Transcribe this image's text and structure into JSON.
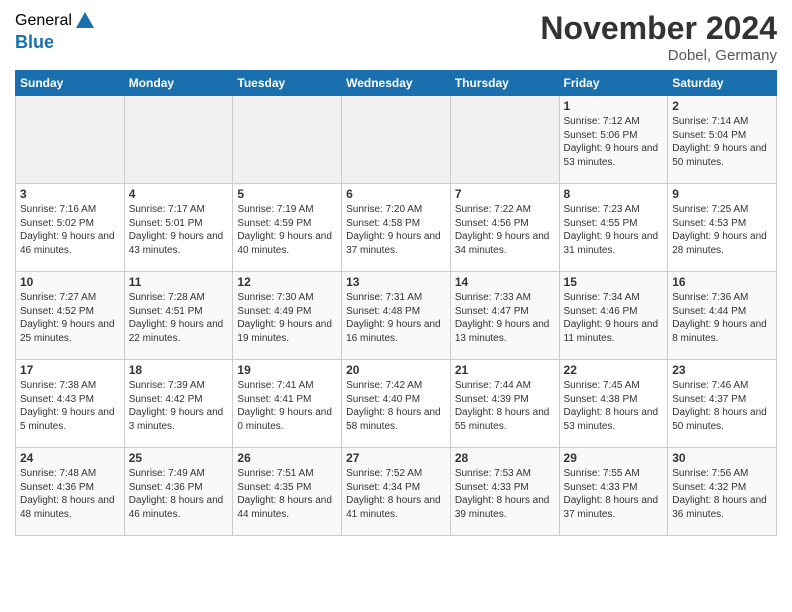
{
  "header": {
    "logo_general": "General",
    "logo_blue": "Blue",
    "title": "November 2024",
    "location": "Dobel, Germany"
  },
  "weekdays": [
    "Sunday",
    "Monday",
    "Tuesday",
    "Wednesday",
    "Thursday",
    "Friday",
    "Saturday"
  ],
  "weeks": [
    [
      {
        "day": "",
        "info": ""
      },
      {
        "day": "",
        "info": ""
      },
      {
        "day": "",
        "info": ""
      },
      {
        "day": "",
        "info": ""
      },
      {
        "day": "",
        "info": ""
      },
      {
        "day": "1",
        "info": "Sunrise: 7:12 AM\nSunset: 5:06 PM\nDaylight: 9 hours and 53 minutes."
      },
      {
        "day": "2",
        "info": "Sunrise: 7:14 AM\nSunset: 5:04 PM\nDaylight: 9 hours and 50 minutes."
      }
    ],
    [
      {
        "day": "3",
        "info": "Sunrise: 7:16 AM\nSunset: 5:02 PM\nDaylight: 9 hours and 46 minutes."
      },
      {
        "day": "4",
        "info": "Sunrise: 7:17 AM\nSunset: 5:01 PM\nDaylight: 9 hours and 43 minutes."
      },
      {
        "day": "5",
        "info": "Sunrise: 7:19 AM\nSunset: 4:59 PM\nDaylight: 9 hours and 40 minutes."
      },
      {
        "day": "6",
        "info": "Sunrise: 7:20 AM\nSunset: 4:58 PM\nDaylight: 9 hours and 37 minutes."
      },
      {
        "day": "7",
        "info": "Sunrise: 7:22 AM\nSunset: 4:56 PM\nDaylight: 9 hours and 34 minutes."
      },
      {
        "day": "8",
        "info": "Sunrise: 7:23 AM\nSunset: 4:55 PM\nDaylight: 9 hours and 31 minutes."
      },
      {
        "day": "9",
        "info": "Sunrise: 7:25 AM\nSunset: 4:53 PM\nDaylight: 9 hours and 28 minutes."
      }
    ],
    [
      {
        "day": "10",
        "info": "Sunrise: 7:27 AM\nSunset: 4:52 PM\nDaylight: 9 hours and 25 minutes."
      },
      {
        "day": "11",
        "info": "Sunrise: 7:28 AM\nSunset: 4:51 PM\nDaylight: 9 hours and 22 minutes."
      },
      {
        "day": "12",
        "info": "Sunrise: 7:30 AM\nSunset: 4:49 PM\nDaylight: 9 hours and 19 minutes."
      },
      {
        "day": "13",
        "info": "Sunrise: 7:31 AM\nSunset: 4:48 PM\nDaylight: 9 hours and 16 minutes."
      },
      {
        "day": "14",
        "info": "Sunrise: 7:33 AM\nSunset: 4:47 PM\nDaylight: 9 hours and 13 minutes."
      },
      {
        "day": "15",
        "info": "Sunrise: 7:34 AM\nSunset: 4:46 PM\nDaylight: 9 hours and 11 minutes."
      },
      {
        "day": "16",
        "info": "Sunrise: 7:36 AM\nSunset: 4:44 PM\nDaylight: 9 hours and 8 minutes."
      }
    ],
    [
      {
        "day": "17",
        "info": "Sunrise: 7:38 AM\nSunset: 4:43 PM\nDaylight: 9 hours and 5 minutes."
      },
      {
        "day": "18",
        "info": "Sunrise: 7:39 AM\nSunset: 4:42 PM\nDaylight: 9 hours and 3 minutes."
      },
      {
        "day": "19",
        "info": "Sunrise: 7:41 AM\nSunset: 4:41 PM\nDaylight: 9 hours and 0 minutes."
      },
      {
        "day": "20",
        "info": "Sunrise: 7:42 AM\nSunset: 4:40 PM\nDaylight: 8 hours and 58 minutes."
      },
      {
        "day": "21",
        "info": "Sunrise: 7:44 AM\nSunset: 4:39 PM\nDaylight: 8 hours and 55 minutes."
      },
      {
        "day": "22",
        "info": "Sunrise: 7:45 AM\nSunset: 4:38 PM\nDaylight: 8 hours and 53 minutes."
      },
      {
        "day": "23",
        "info": "Sunrise: 7:46 AM\nSunset: 4:37 PM\nDaylight: 8 hours and 50 minutes."
      }
    ],
    [
      {
        "day": "24",
        "info": "Sunrise: 7:48 AM\nSunset: 4:36 PM\nDaylight: 8 hours and 48 minutes."
      },
      {
        "day": "25",
        "info": "Sunrise: 7:49 AM\nSunset: 4:36 PM\nDaylight: 8 hours and 46 minutes."
      },
      {
        "day": "26",
        "info": "Sunrise: 7:51 AM\nSunset: 4:35 PM\nDaylight: 8 hours and 44 minutes."
      },
      {
        "day": "27",
        "info": "Sunrise: 7:52 AM\nSunset: 4:34 PM\nDaylight: 8 hours and 41 minutes."
      },
      {
        "day": "28",
        "info": "Sunrise: 7:53 AM\nSunset: 4:33 PM\nDaylight: 8 hours and 39 minutes."
      },
      {
        "day": "29",
        "info": "Sunrise: 7:55 AM\nSunset: 4:33 PM\nDaylight: 8 hours and 37 minutes."
      },
      {
        "day": "30",
        "info": "Sunrise: 7:56 AM\nSunset: 4:32 PM\nDaylight: 8 hours and 36 minutes."
      }
    ]
  ]
}
